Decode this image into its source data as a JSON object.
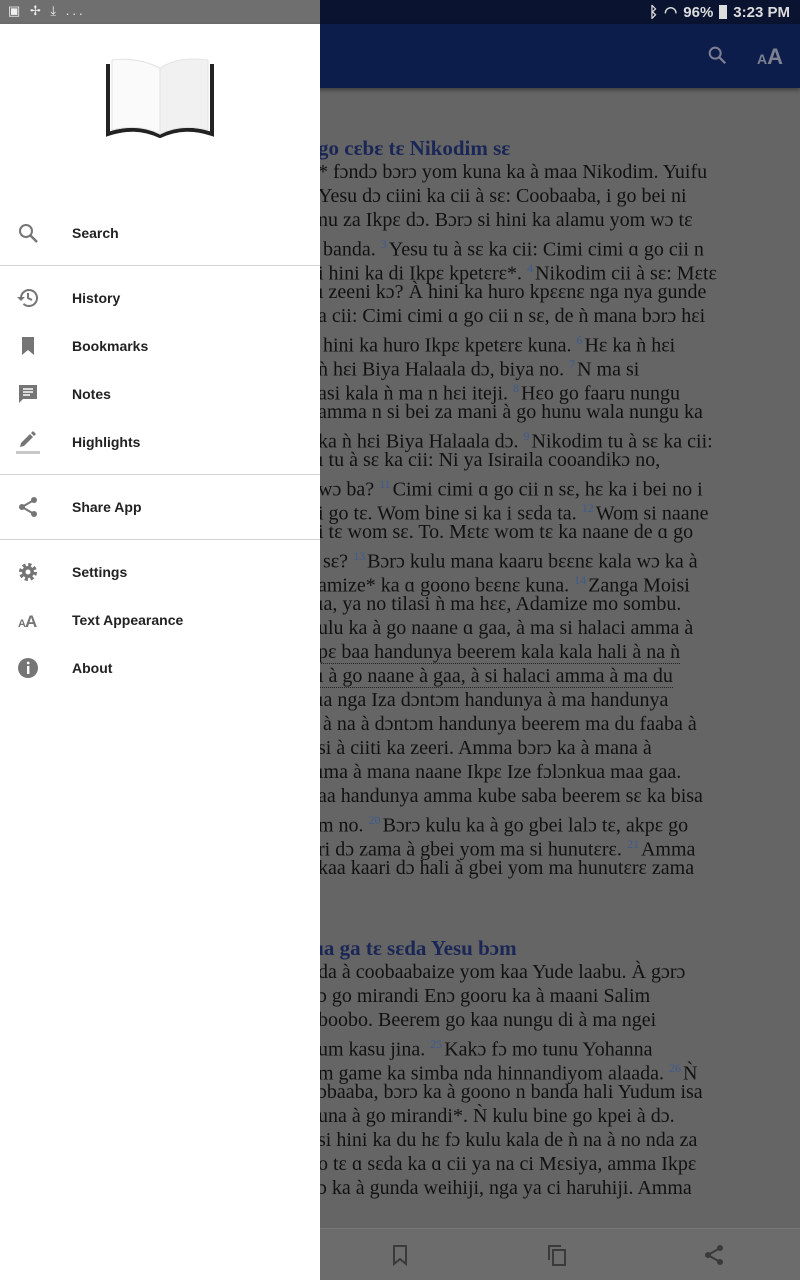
{
  "status_bar": {
    "left_icons": [
      "image-icon",
      "pinwheel-icon",
      "download-icon"
    ],
    "overflow": "...",
    "battery": "96%",
    "time": "3:23 PM"
  },
  "app_bar": {
    "icons": [
      "search-icon",
      "text-size-icon"
    ],
    "color": "#0c1d4b"
  },
  "drawer": {
    "groups": [
      [
        {
          "label": "Search",
          "icon": "search-icon"
        }
      ],
      [
        {
          "label": "History",
          "icon": "history-icon"
        },
        {
          "label": "Bookmarks",
          "icon": "bookmark-icon"
        },
        {
          "label": "Notes",
          "icon": "notes-icon"
        },
        {
          "label": "Highlights",
          "icon": "highlight-icon"
        }
      ],
      [
        {
          "label": "Share App",
          "icon": "share-icon"
        }
      ],
      [
        {
          "label": "Settings",
          "icon": "gear-icon"
        },
        {
          "label": "Text Appearance",
          "icon": "text-size-icon"
        },
        {
          "label": "About",
          "icon": "info-icon"
        }
      ]
    ]
  },
  "reader": {
    "blocks": [
      {
        "heading": "go cɛbɛ tɛ Nikodim sɛ"
      },
      {
        "seg": [
          {
            "t": "* fɔndɔ bɔrɔ yom kuna ka à maa Nikodim. Yuifu"
          }
        ]
      },
      {
        "seg": [
          {
            "t": "Yesu dɔ ciini ka cii à sɛ: Coobaaba, i go bei ni"
          }
        ]
      },
      {
        "seg": [
          {
            "t": "nu za Ikpɛ dɔ. Bɔrɔ si hini ka alamu yom wɔ tɛ"
          }
        ]
      },
      {
        "seg": [
          {
            "t": " banda. "
          },
          {
            "v": "3"
          },
          {
            "t": "Yesu tu à sɛ ka cii: Cimi cimi ɑ go cii n"
          }
        ]
      },
      {
        "seg": [
          {
            "t": "i hini ka di Ikpɛ kpetɛrɛ*. "
          },
          {
            "v": "4"
          },
          {
            "t": "Nikodim cii à sɛ: Mɛtɛ"
          }
        ]
      },
      {
        "seg": [
          {
            "t": "ı zeeni kɔ? À hini ka huro kpɛɛnɛ nga nya gunde"
          }
        ]
      },
      {
        "seg": [
          {
            "t": "a cii: Cimi cimi ɑ go cii n sɛ, de ǹ mana bɔrɔ hɛi"
          }
        ]
      },
      {
        "seg": [
          {
            "t": " hini ka huro Ikpɛ kpetɛrɛ kuna. "
          },
          {
            "v": "6"
          },
          {
            "t": "Hɛ ka ǹ hɛi"
          }
        ]
      },
      {
        "seg": [
          {
            "t": "ǹ hɛi Biya Halaala dɔ, biya no. "
          },
          {
            "v": "7"
          },
          {
            "t": "N ma si"
          }
        ]
      },
      {
        "seg": [
          {
            "t": "asi kala ǹ ma n hɛi iteji. "
          },
          {
            "v": "8"
          },
          {
            "t": "Hɛo go faaru nungu"
          }
        ]
      },
      {
        "seg": [
          {
            "t": "amma n si bei za mani à go hunu wala nungu ka"
          }
        ]
      },
      {
        "seg": [
          {
            "t": "ka ǹ hɛi Biya Halaala dɔ. "
          },
          {
            "v": "9"
          },
          {
            "t": "Nikodim tu à sɛ ka cii:"
          }
        ]
      },
      {
        "seg": [
          {
            "t": "ı tu à sɛ ka cii: Ni ya Isiraila cooandikɔ no,"
          }
        ]
      },
      {
        "seg": [
          {
            "t": "wɔ ba? "
          },
          {
            "v": "11"
          },
          {
            "t": "Cimi cimi ɑ go cii n sɛ, hɛ ka i bei no i"
          }
        ]
      },
      {
        "seg": [
          {
            "t": "i go tɛ. Wom bine si ka i sɛda ta. "
          },
          {
            "v": "12"
          },
          {
            "t": "Wom si naane"
          }
        ]
      },
      {
        "seg": [
          {
            "t": "i tɛ wom sɛ. To. Mɛtɛ wom tɛ ka naane de ɑ go"
          }
        ]
      },
      {
        "seg": [
          {
            "t": " sɛ? "
          },
          {
            "v": "13"
          },
          {
            "t": "Bɔrɔ kulu mana kaaru bɛɛnɛ kala wɔ ka à"
          }
        ]
      },
      {
        "seg": [
          {
            "t": "amize* ka ɑ goono bɛɛnɛ kuna. "
          },
          {
            "v": "14"
          },
          {
            "t": "Zanga Moisi"
          }
        ]
      },
      {
        "seg": [
          {
            "t": "ıa, ya no tilasi ǹ ma hɛɛ, Adamize mo sombu."
          }
        ]
      },
      {
        "seg": [
          {
            "t": "ulu ka à go naane ɑ gaa, à ma si halaci amma à"
          }
        ]
      },
      {
        "u": true,
        "seg": [
          {
            "t": "pɛ baa handunya beerem kala kala hali à na ǹ"
          }
        ]
      },
      {
        "u": true,
        "seg": [
          {
            "t": "ı à go naane à gaa, à si halaci amma à ma du"
          }
        ]
      },
      {
        "seg": [
          {
            "t": "ıa nga Iza dɔntɔm handunya à ma handunya"
          }
        ]
      },
      {
        "seg": [
          {
            "t": " à na à dɔntɔm handunya beerem ma du faaba à"
          }
        ]
      },
      {
        "seg": [
          {
            "t": "si à ciiti ka zeeri. Amma bɔrɔ ka à mana à"
          }
        ]
      },
      {
        "seg": [
          {
            "t": "ıma à mana naane Ikpɛ Ize fɔlɔnkua maa gaa."
          }
        ]
      },
      {
        "seg": [
          {
            "t": "aa handunya amma kube saba beerem sɛ ka bisa"
          }
        ]
      },
      {
        "seg": [
          {
            "t": "m no. "
          },
          {
            "v": "20"
          },
          {
            "t": "Bɔrɔ kulu ka à go gbei lalɔ tɛ, akpɛ go"
          }
        ]
      },
      {
        "seg": [
          {
            "t": "ri dɔ zama à gbei yom ma si hunutɛrɛ. "
          },
          {
            "v": "21"
          },
          {
            "t": "Amma"
          }
        ]
      },
      {
        "seg": [
          {
            "t": "kaa kaari dɔ hali à gbei yom ma hunutɛrɛ zama"
          }
        ]
      },
      {
        "heading": "ıa ga tɛ sɛda Yesu bɔm"
      },
      {
        "seg": [
          {
            "t": "da à coobaabaize yom kaa Yude laabu. À gɔrɔ"
          }
        ]
      },
      {
        "seg": [
          {
            "t": "ɔ go mirandi Enɔ gooru ka à maani Salim"
          }
        ]
      },
      {
        "seg": [
          {
            "t": "boobo. Beerem go kaa nungu di à ma ngei"
          }
        ]
      },
      {
        "seg": [
          {
            "t": "um kasu jina. "
          },
          {
            "v": "25"
          },
          {
            "t": "Kakɔ fɔ mo tunu Yohanna"
          }
        ]
      },
      {
        "seg": [
          {
            "t": "m game ka simba nda hinnandiyom alaada. "
          },
          {
            "v": "26"
          },
          {
            "t": "Ǹ"
          }
        ]
      },
      {
        "seg": [
          {
            "t": "ɔbaaba, bɔrɔ ka à goono n banda hali Yudum isa"
          }
        ]
      },
      {
        "seg": [
          {
            "t": "una à go mirandi*. Ǹ kulu bine go kpei à dɔ."
          }
        ]
      },
      {
        "seg": [
          {
            "t": "si hini ka du hɛ fɔ kulu kala de ǹ na à no nda za"
          }
        ]
      },
      {
        "seg": [
          {
            "t": "o tɛ ɑ sɛda ka ɑ cii ya na ci Mɛsiya, amma Ikpɛ"
          }
        ]
      },
      {
        "seg": [
          {
            "t": "ɔ ka à gunda weihiji, nga ya ci haruhiji. Amma"
          }
        ]
      }
    ]
  },
  "bottom_bar": {
    "icons": [
      "bookmark-outline-icon",
      "copy-icon",
      "share-icon"
    ]
  }
}
